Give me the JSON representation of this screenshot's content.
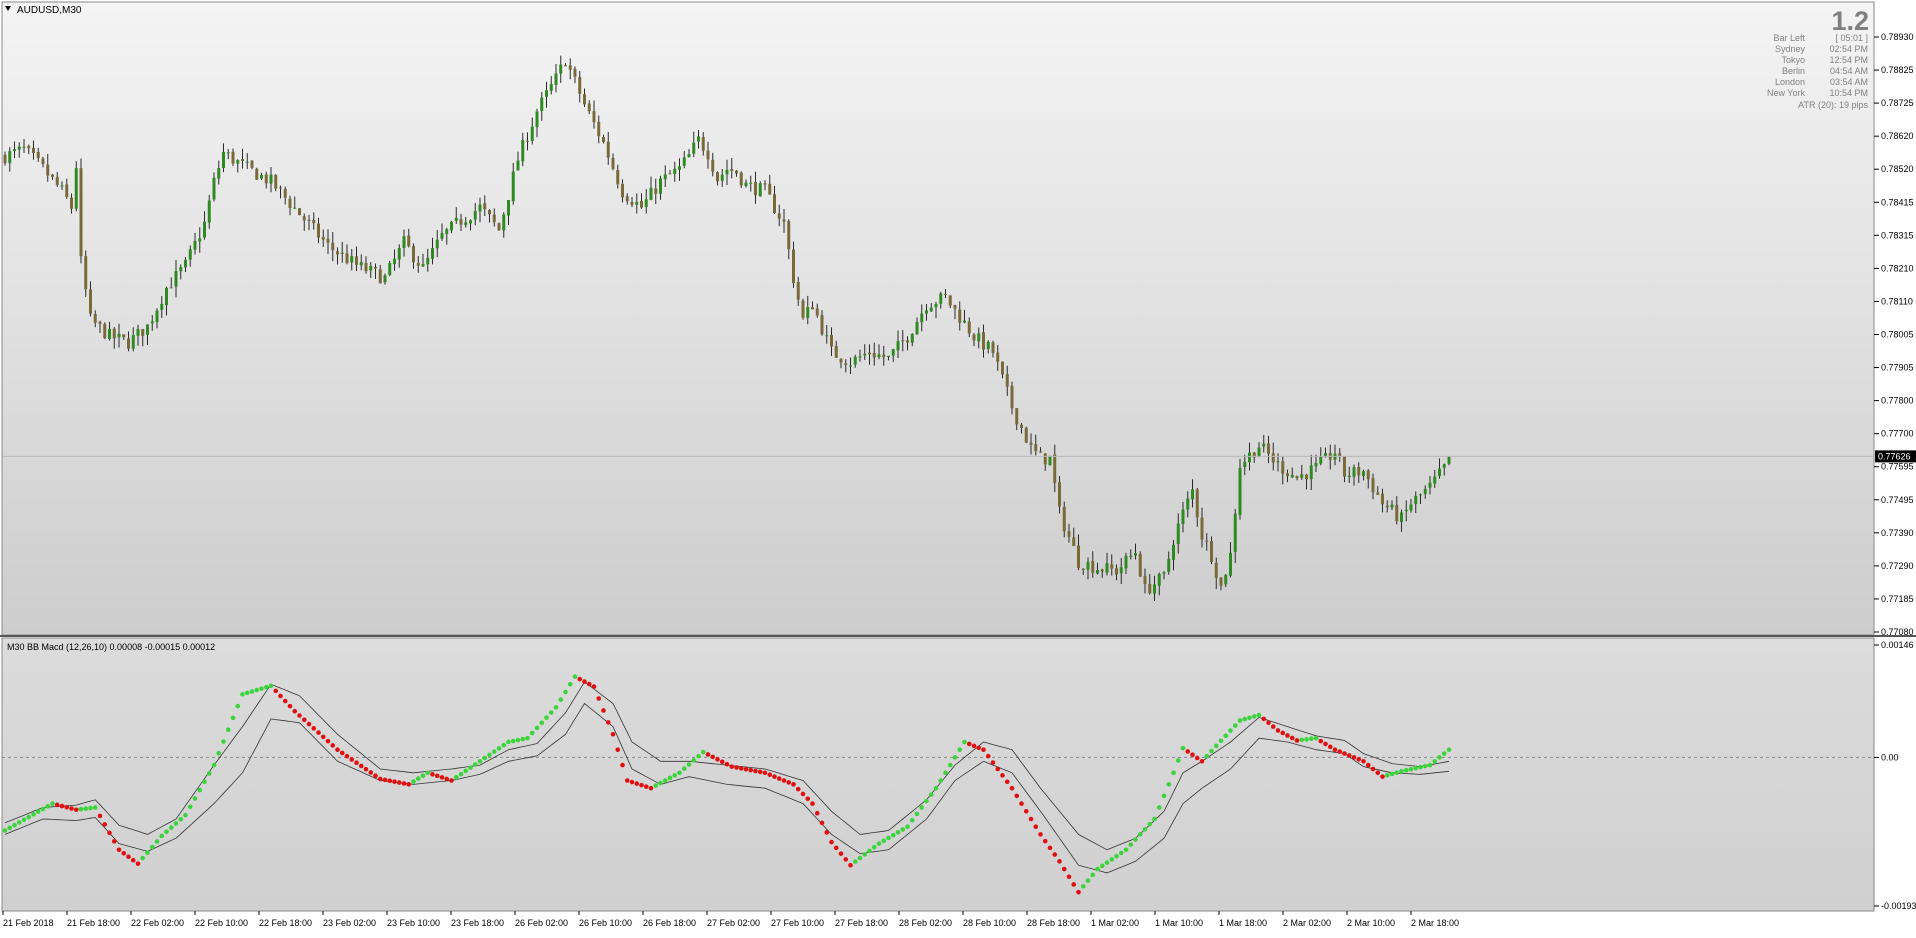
{
  "main_panel": {
    "symbol_label": "AUDUSD,M30",
    "big_number": "1.2",
    "info": [
      {
        "label": "Bar Left",
        "value": "[ 05:01 ]"
      },
      {
        "label": "Sydney",
        "value": "02:54 PM"
      },
      {
        "label": "Tokyo",
        "value": "12:54 PM"
      },
      {
        "label": "Berlin",
        "value": "04:54 AM"
      },
      {
        "label": "London",
        "value": "03:54 AM"
      },
      {
        "label": "New York",
        "value": "10:54 PM"
      }
    ],
    "atr_text": "ATR (20): 19 pips",
    "current_price": "0.77626"
  },
  "indicator_panel": {
    "label": "M30 BB Macd (12,26,10) 0.00008 -0.00015 0.00012"
  },
  "colors": {
    "candle_up": "#2e8b22",
    "candle_down": "#7a6a3a",
    "dot_up": "#3cd43c",
    "dot_down": "#e01010",
    "band": "#333333",
    "background_top": "#f4f4f4",
    "background_bottom": "#cdcdcd"
  },
  "chart_data": [
    {
      "type": "candlestick",
      "title": "AUDUSD,M30",
      "ylim": [
        0.7708,
        0.7893
      ],
      "y_ticks": [
        "0.78930",
        "0.78825",
        "0.78725",
        "0.78620",
        "0.78520",
        "0.78415",
        "0.78315",
        "0.78210",
        "0.78110",
        "0.78005",
        "0.77905",
        "0.77800",
        "0.77700",
        "0.77595",
        "0.77495",
        "0.77390",
        "0.77290",
        "0.77185",
        "0.77080"
      ],
      "x_ticks": [
        "21 Feb 2018",
        "21 Feb 18:00",
        "22 Feb 02:00",
        "22 Feb 10:00",
        "22 Feb 18:00",
        "23 Feb 02:00",
        "23 Feb 10:00",
        "23 Feb 18:00",
        "26 Feb 02:00",
        "26 Feb 10:00",
        "26 Feb 18:00",
        "27 Feb 02:00",
        "27 Feb 10:00",
        "27 Feb 18:00",
        "28 Feb 02:00",
        "28 Feb 10:00",
        "28 Feb 18:00",
        "1 Mar 02:00",
        "1 Mar 10:00",
        "1 Mar 18:00",
        "2 Mar 02:00",
        "2 Mar 10:00",
        "2 Mar 18:00"
      ],
      "close_path": [
        [
          0,
          0.7856
        ],
        [
          4,
          0.7858
        ],
        [
          8,
          0.7852
        ],
        [
          12,
          0.7845
        ],
        [
          14,
          0.784
        ],
        [
          15,
          0.7853
        ],
        [
          16,
          0.7823
        ],
        [
          18,
          0.7805
        ],
        [
          22,
          0.78
        ],
        [
          26,
          0.7798
        ],
        [
          30,
          0.7803
        ],
        [
          34,
          0.7815
        ],
        [
          38,
          0.7822
        ],
        [
          42,
          0.7835
        ],
        [
          44,
          0.7848
        ],
        [
          46,
          0.7857
        ],
        [
          50,
          0.7853
        ],
        [
          56,
          0.7848
        ],
        [
          62,
          0.7838
        ],
        [
          68,
          0.7828
        ],
        [
          74,
          0.7822
        ],
        [
          80,
          0.7818
        ],
        [
          84,
          0.7829
        ],
        [
          88,
          0.7821
        ],
        [
          92,
          0.7831
        ],
        [
          96,
          0.7836
        ],
        [
          100,
          0.784
        ],
        [
          104,
          0.7833
        ],
        [
          108,
          0.7855
        ],
        [
          112,
          0.787
        ],
        [
          116,
          0.788
        ],
        [
          118,
          0.7886
        ],
        [
          122,
          0.7872
        ],
        [
          126,
          0.786
        ],
        [
          130,
          0.7845
        ],
        [
          134,
          0.784
        ],
        [
          138,
          0.7848
        ],
        [
          142,
          0.7852
        ],
        [
          144,
          0.7856
        ],
        [
          146,
          0.7861
        ],
        [
          148,
          0.7857
        ],
        [
          150,
          0.7849
        ],
        [
          152,
          0.7852
        ],
        [
          154,
          0.7851
        ],
        [
          156,
          0.7847
        ],
        [
          160,
          0.7845
        ],
        [
          164,
          0.7835
        ],
        [
          166,
          0.7818
        ],
        [
          168,
          0.7805
        ],
        [
          170,
          0.781
        ],
        [
          174,
          0.7795
        ],
        [
          178,
          0.7792
        ],
        [
          182,
          0.7795
        ],
        [
          186,
          0.7793
        ],
        [
          190,
          0.78
        ],
        [
          194,
          0.781
        ],
        [
          198,
          0.7812
        ],
        [
          200,
          0.7808
        ],
        [
          204,
          0.78
        ],
        [
          208,
          0.7795
        ],
        [
          212,
          0.7778
        ],
        [
          216,
          0.7765
        ],
        [
          218,
          0.7762
        ],
        [
          220,
          0.7762
        ],
        [
          222,
          0.7745
        ],
        [
          226,
          0.773
        ],
        [
          230,
          0.7728
        ],
        [
          234,
          0.7727
        ],
        [
          238,
          0.7733
        ],
        [
          240,
          0.7721
        ],
        [
          244,
          0.7725
        ],
        [
          246,
          0.7737
        ],
        [
          248,
          0.7745
        ],
        [
          250,
          0.7752
        ],
        [
          252,
          0.7738
        ],
        [
          254,
          0.7732
        ],
        [
          256,
          0.7722
        ],
        [
          258,
          0.7732
        ],
        [
          260,
          0.776
        ],
        [
          264,
          0.7766
        ],
        [
          268,
          0.776
        ],
        [
          272,
          0.7756
        ],
        [
          276,
          0.7759
        ],
        [
          280,
          0.7764
        ],
        [
          282,
          0.7757
        ],
        [
          286,
          0.7758
        ],
        [
          290,
          0.7748
        ],
        [
          294,
          0.7743
        ],
        [
          296,
          0.7748
        ],
        [
          300,
          0.7753
        ],
        [
          304,
          0.7761
        ]
      ],
      "current_price": 0.77626
    },
    {
      "type": "line",
      "title": "M30 BB Macd (12,26,10) 0.00008 -0.00015 0.00012",
      "ylim": [
        -0.00193,
        0.00146
      ],
      "y_ticks": [
        "0.00146",
        "0.00",
        "-0.00193"
      ],
      "zero_line": true,
      "series": [
        {
          "key": "macd_dots",
          "style": "dots colored by direction (rising green, falling red)",
          "values": [
            [
              0,
              -0.00095
            ],
            [
              10,
              -0.0006
            ],
            [
              15,
              -0.00068
            ],
            [
              19,
              -0.00065
            ],
            [
              24,
              -0.0012
            ],
            [
              28,
              -0.00138
            ],
            [
              33,
              -0.00102
            ],
            [
              38,
              -0.00075
            ],
            [
              44,
              -0.0001
            ],
            [
              50,
              0.00082
            ],
            [
              56,
              0.00093
            ],
            [
              61,
              0.0006
            ],
            [
              70,
              0.0001
            ],
            [
              79,
              -0.00028
            ],
            [
              85,
              -0.00035
            ],
            [
              89,
              -0.0002
            ],
            [
              94,
              -0.0003
            ],
            [
              100,
              -5e-05
            ],
            [
              106,
              0.0002
            ],
            [
              110,
              0.00025
            ],
            [
              116,
              0.00065
            ],
            [
              120,
              0.00105
            ],
            [
              124,
              0.00092
            ],
            [
              128,
              0.0003
            ],
            [
              131,
              -0.0003
            ],
            [
              136,
              -0.0004
            ],
            [
              142,
              -0.0002
            ],
            [
              147,
              7e-05
            ],
            [
              153,
              -0.00012
            ],
            [
              160,
              -0.0002
            ],
            [
              166,
              -0.00035
            ],
            [
              170,
              -0.0006
            ],
            [
              174,
              -0.0011
            ],
            [
              178,
              -0.0014
            ],
            [
              184,
              -0.00112
            ],
            [
              190,
              -0.0009
            ],
            [
              196,
              -0.0004
            ],
            [
              202,
              0.0002
            ],
            [
              206,
              0.0001
            ],
            [
              212,
              -0.0004
            ],
            [
              218,
              -0.001
            ],
            [
              222,
              -0.00135
            ],
            [
              226,
              -0.00175
            ],
            [
              230,
              -0.00145
            ],
            [
              236,
              -0.0012
            ],
            [
              242,
              -0.0008
            ],
            [
              246,
              -0.0002
            ],
            [
              248,
              0.00012
            ],
            [
              252,
              -5e-05
            ],
            [
              255,
              0.00015
            ],
            [
              260,
              0.00048
            ],
            [
              264,
              0.00055
            ],
            [
              268,
              0.00035
            ],
            [
              272,
              0.00022
            ],
            [
              276,
              0.00025
            ],
            [
              280,
              0.0001
            ],
            [
              286,
              -5e-05
            ],
            [
              290,
              -0.00025
            ],
            [
              294,
              -0.00018
            ],
            [
              300,
              -0.0001
            ],
            [
              304,
              0.0001
            ]
          ]
        },
        {
          "key": "band_upper",
          "style": "thin gray line",
          "values": [
            [
              0,
              -0.00085
            ],
            [
              8,
              -0.00065
            ],
            [
              15,
              -0.00062
            ],
            [
              19,
              -0.00055
            ],
            [
              24,
              -0.00088
            ],
            [
              30,
              -0.001
            ],
            [
              36,
              -0.0008
            ],
            [
              44,
              -0.0001
            ],
            [
              50,
              0.0004
            ],
            [
              56,
              0.00095
            ],
            [
              62,
              0.0008
            ],
            [
              70,
              0.0003
            ],
            [
              79,
              -0.00015
            ],
            [
              86,
              -0.0002
            ],
            [
              94,
              -0.00015
            ],
            [
              100,
              -0.0001
            ],
            [
              106,
              0.0001
            ],
            [
              112,
              0.00018
            ],
            [
              118,
              0.00058
            ],
            [
              122,
              0.00098
            ],
            [
              128,
              0.0007
            ],
            [
              132,
              0.0002
            ],
            [
              138,
              -5e-05
            ],
            [
              144,
              -5e-05
            ],
            [
              152,
              -0.0001
            ],
            [
              160,
              -0.00015
            ],
            [
              168,
              -0.0003
            ],
            [
              174,
              -0.0007
            ],
            [
              180,
              -0.001
            ],
            [
              186,
              -0.00095
            ],
            [
              194,
              -0.00055
            ],
            [
              200,
              -0.0001
            ],
            [
              206,
              0.0002
            ],
            [
              212,
              0.0001
            ],
            [
              218,
              -0.0004
            ],
            [
              226,
              -0.001
            ],
            [
              232,
              -0.0012
            ],
            [
              238,
              -0.00105
            ],
            [
              244,
              -0.0007
            ],
            [
              248,
              -0.0002
            ],
            [
              252,
              -5e-05
            ],
            [
              258,
              0.0002
            ],
            [
              264,
              0.00052
            ],
            [
              270,
              0.0004
            ],
            [
              276,
              0.00028
            ],
            [
              282,
              0.00022
            ],
            [
              286,
              5e-05
            ],
            [
              292,
              -8e-05
            ],
            [
              298,
              -0.00012
            ],
            [
              304,
              -5e-05
            ]
          ]
        },
        {
          "key": "band_lower",
          "style": "thin gray line",
          "values": [
            [
              0,
              -0.001
            ],
            [
              8,
              -0.0008
            ],
            [
              15,
              -0.00082
            ],
            [
              19,
              -0.00078
            ],
            [
              24,
              -0.00112
            ],
            [
              30,
              -0.00122
            ],
            [
              36,
              -0.00105
            ],
            [
              44,
              -0.0006
            ],
            [
              50,
              -0.0002
            ],
            [
              56,
              0.0005
            ],
            [
              62,
              0.00045
            ],
            [
              70,
              -5e-05
            ],
            [
              79,
              -0.0003
            ],
            [
              86,
              -0.00035
            ],
            [
              94,
              -0.0003
            ],
            [
              100,
              -0.00022
            ],
            [
              106,
              -5e-05
            ],
            [
              112,
              2e-05
            ],
            [
              118,
              0.0003
            ],
            [
              122,
              0.0007
            ],
            [
              128,
              0.0004
            ],
            [
              132,
              -0.00015
            ],
            [
              138,
              -0.00035
            ],
            [
              144,
              -0.00025
            ],
            [
              152,
              -0.00035
            ],
            [
              160,
              -0.0004
            ],
            [
              168,
              -0.0006
            ],
            [
              174,
              -0.001
            ],
            [
              180,
              -0.00125
            ],
            [
              186,
              -0.0012
            ],
            [
              194,
              -0.0008
            ],
            [
              200,
              -0.0003
            ],
            [
              206,
              -5e-05
            ],
            [
              212,
              -0.0002
            ],
            [
              218,
              -0.0007
            ],
            [
              226,
              -0.0014
            ],
            [
              232,
              -0.0015
            ],
            [
              238,
              -0.00135
            ],
            [
              244,
              -0.00105
            ],
            [
              248,
              -0.0006
            ],
            [
              252,
              -0.0004
            ],
            [
              258,
              -0.00015
            ],
            [
              264,
              0.00025
            ],
            [
              270,
              0.0002
            ],
            [
              276,
              0.0001
            ],
            [
              282,
              5e-05
            ],
            [
              286,
              -0.00012
            ],
            [
              292,
              -0.0002
            ],
            [
              298,
              -0.00022
            ],
            [
              304,
              -0.00018
            ]
          ]
        }
      ]
    }
  ]
}
